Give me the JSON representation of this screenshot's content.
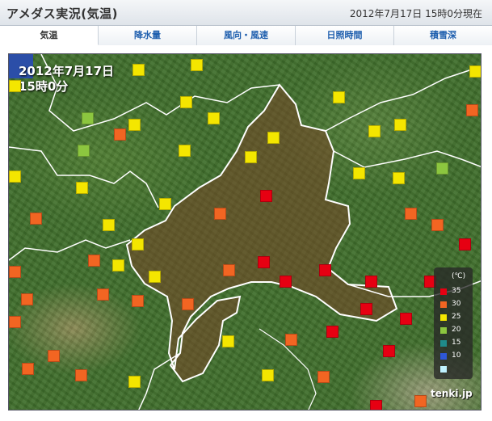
{
  "header": {
    "title": "アメダス実況(気温)",
    "timestamp": "2012年7月17日 15時0分現在"
  },
  "tabs": [
    {
      "label": "気温",
      "active": true
    },
    {
      "label": "降水量",
      "active": false
    },
    {
      "label": "風向・風速",
      "active": false
    },
    {
      "label": "日照時間",
      "active": false
    },
    {
      "label": "積雪深",
      "active": false
    }
  ],
  "map": {
    "date_line1": "2012年7月17日",
    "date_line2": "15時0分",
    "logo": "tenki.jp",
    "colors": {
      "red": "#e60012",
      "orange": "#f26522",
      "yellow": "#f4e600",
      "lime": "#8cc63f"
    }
  },
  "legend": {
    "unit": "(℃)",
    "items": [
      {
        "label": "35",
        "color": "#e60012"
      },
      {
        "label": "30",
        "color": "#f26522"
      },
      {
        "label": "25",
        "color": "#f4e600"
      },
      {
        "label": "20",
        "color": "#8cc63f"
      },
      {
        "label": "15",
        "color": "#1f8a8a"
      },
      {
        "label": "10",
        "color": "#2e57d6"
      },
      {
        "label": "",
        "color": "#bff2ff"
      }
    ]
  }
}
